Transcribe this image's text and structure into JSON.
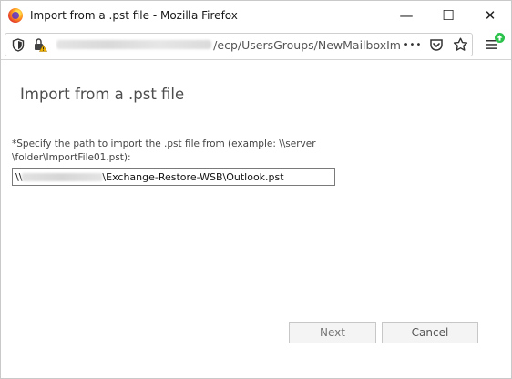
{
  "window": {
    "title": "Import from a .pst file - Mozilla Firefox",
    "minimize_glyph": "—",
    "maximize_glyph": "☐",
    "close_glyph": "✕"
  },
  "urlbar": {
    "url_visible_path": "/ecp/UsersGroups/NewMailboxIm",
    "more_glyph": "•••",
    "icons": [
      "shield-icon",
      "lock-warning-icon",
      "pocket-icon",
      "star-icon",
      "hamburger-menu-icon",
      "update-badge-icon"
    ]
  },
  "page": {
    "heading": "Import from a .pst file",
    "field_label": "*Specify the path to import the .pst file from (example: \\\\server \\folder\\ImportFile01.pst):",
    "path_prefix": "\\\\",
    "path_suffix": "\\Exchange-Restore-WSB\\Outlook.pst",
    "next_label": "Next",
    "cancel_label": "Cancel"
  },
  "colors": {
    "accent_green": "#2ac24a",
    "heading_gray": "#4d4d4d",
    "border_gray": "#c7c7c7"
  }
}
